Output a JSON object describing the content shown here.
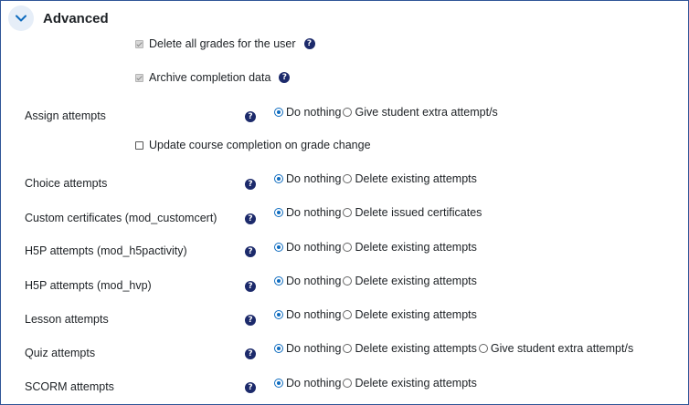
{
  "section": {
    "title": "Advanced",
    "collapse_icon": "chevron-down-icon"
  },
  "checkboxes": {
    "delete_grades": {
      "label": "Delete all grades for the user",
      "checked": true,
      "disabled": true
    },
    "archive_completion": {
      "label": "Archive completion data",
      "checked": true,
      "disabled": true
    },
    "update_completion": {
      "label": "Update course completion on grade change",
      "checked": false,
      "disabled": false
    }
  },
  "help_icon": "?",
  "rows": [
    {
      "label": "Assign attempts",
      "options": [
        "Do nothing",
        "Give student extra attempt/s"
      ],
      "selected": 0
    },
    {
      "label": "Choice attempts",
      "options": [
        "Do nothing",
        "Delete existing attempts"
      ],
      "selected": 0
    },
    {
      "label": "Custom certificates (mod_customcert)",
      "options": [
        "Do nothing",
        "Delete issued certificates"
      ],
      "selected": 0
    },
    {
      "label": "H5P attempts (mod_h5pactivity)",
      "options": [
        "Do nothing",
        "Delete existing attempts"
      ],
      "selected": 0
    },
    {
      "label": "H5P attempts (mod_hvp)",
      "options": [
        "Do nothing",
        "Delete existing attempts"
      ],
      "selected": 0
    },
    {
      "label": "Lesson attempts",
      "options": [
        "Do nothing",
        "Delete existing attempts"
      ],
      "selected": 0
    },
    {
      "label": "Quiz attempts",
      "options": [
        "Do nothing",
        "Delete existing attempts",
        "Give student extra attempt/s"
      ],
      "selected": 0
    },
    {
      "label": "SCORM attempts",
      "options": [
        "Do nothing",
        "Delete existing attempts"
      ],
      "selected": 0
    }
  ],
  "colors": {
    "accent": "#0f6cbf",
    "help_icon": "#1c2a6b",
    "frame_border": "#2f5597"
  }
}
